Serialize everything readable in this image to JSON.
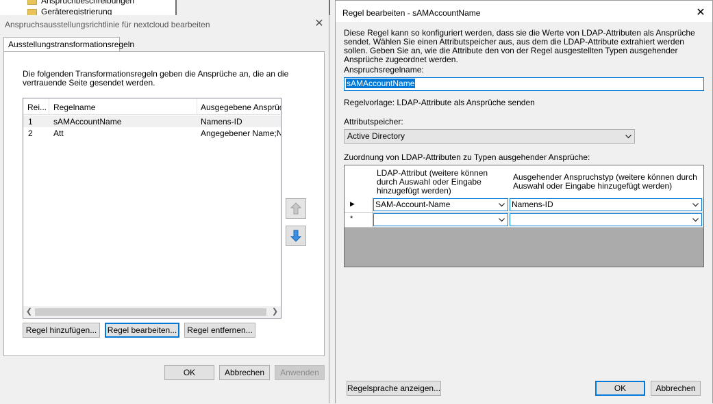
{
  "background": {
    "tree_items": [
      "Anspruchbeschreibungen",
      "Geräteregistrierung"
    ]
  },
  "left_dialog": {
    "title": "Anspruchsausstellungsrichtlinie für nextcloud bearbeiten",
    "tab": "Ausstellungstransformationsregeln",
    "description": "Die folgenden Transformationsregeln geben die Ansprüche an, die an die vertrauende Seite gesendet werden.",
    "columns": [
      "Rei...",
      "Regelname",
      "Ausgegebene Ansprüch"
    ],
    "rows": [
      {
        "order": "1",
        "name": "sAMAccountName",
        "claims": "Namens-ID"
      },
      {
        "order": "2",
        "name": "Att",
        "claims": "Angegebener Name;Nac"
      }
    ],
    "buttons": {
      "add": "Regel hinzufügen...",
      "edit": "Regel bearbeiten...",
      "remove": "Regel entfernen...",
      "ok": "OK",
      "cancel": "Abbrechen",
      "apply": "Anwenden"
    },
    "icons": {
      "up": "arrow-up-icon",
      "down": "arrow-down-icon"
    }
  },
  "right_dialog": {
    "title": "Regel bearbeiten - sAMAccountName",
    "intro": "Diese Regel kann so konfiguriert werden, dass sie die Werte von LDAP-Attributen als Ansprüche sendet. Wählen Sie einen Attributspeicher aus, aus dem die LDAP-Attribute extrahiert werden sollen. Geben Sie an, wie die Attribute den von der Regel ausgestellten Typen ausgehender Ansprüche zugeordnet werden.",
    "rule_name_label": "Anspruchsregelname:",
    "rule_name_value": "sAMAccountName",
    "template_text": "Regelvorlage: LDAP-Attribute als Ansprüche senden",
    "store_label": "Attributspeicher:",
    "store_value": "Active Directory",
    "mapping_label": "Zuordnung von LDAP-Attributen zu Typen ausgehender Ansprüche:",
    "grid": {
      "col1": "LDAP-Attribut (weitere können durch Auswahl oder Eingabe hinzugefügt werden)",
      "col2": "Ausgehender Anspruchstyp (weitere können durch Auswahl oder Eingabe hinzugefügt werden)",
      "rows": [
        {
          "marker": "▶",
          "attr": "SAM-Account-Name",
          "claim": "Namens-ID"
        },
        {
          "marker": "*",
          "attr": "",
          "claim": ""
        }
      ]
    },
    "buttons": {
      "show_language": "Regelsprache anzeigen...",
      "ok": "OK",
      "cancel": "Abbrechen"
    }
  },
  "colors": {
    "accent": "#0078d7",
    "button_face": "#e1e1e1",
    "dialog_bg": "#f0f0f0"
  }
}
